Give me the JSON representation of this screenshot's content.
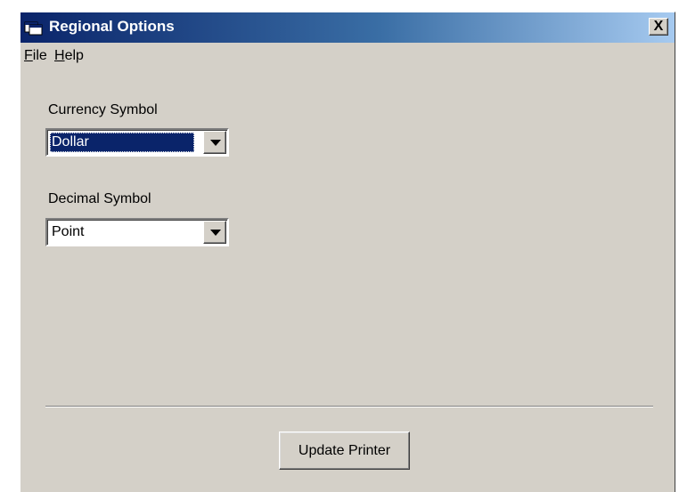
{
  "window": {
    "title": "Regional Options",
    "close_label": "X",
    "icon": "app-window-icon"
  },
  "menu": {
    "items": [
      {
        "label": "File",
        "accel": "F",
        "rest": "ile"
      },
      {
        "label": "Help",
        "accel": "H",
        "rest": "elp"
      }
    ]
  },
  "currency": {
    "label": "Currency Symbol",
    "value": "Dollar"
  },
  "decimal": {
    "label": "Decimal Symbol",
    "value": "Point"
  },
  "actions": {
    "update_label": "Update Printer"
  },
  "colors": {
    "title_gradient_start": "#0a246a",
    "title_gradient_end": "#a6caf0",
    "face": "#d4d0c8",
    "selection": "#0a246a"
  }
}
